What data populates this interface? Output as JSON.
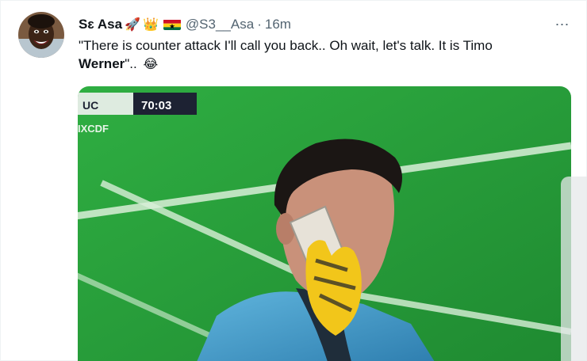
{
  "tweet": {
    "display_name": "Sɛ Asa",
    "emojis": [
      "🚀",
      "👑"
    ],
    "handle": "@S3__Asa",
    "separator": "·",
    "time": "16m",
    "more_icon": "⋯",
    "text_line1": "\"There is counter attack I'll call you back.. Oh wait, let's talk. It is Timo",
    "text_bold": "Werner",
    "text_after": "\"..",
    "laugh_emoji": "😂"
  },
  "scorebug": {
    "team": "UC",
    "clock": "70:03",
    "subtext": "IXCDF"
  },
  "colors": {
    "pitch": "#27a23a",
    "pitch_dark": "#1f8a31",
    "text_muted": "#536471",
    "flag_red": "#ce1126",
    "flag_gold": "#fcd116",
    "flag_green": "#006b3f"
  }
}
